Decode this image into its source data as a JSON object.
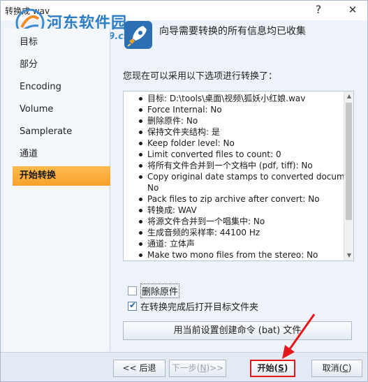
{
  "window": {
    "title": "转换成 wav",
    "help_glyph": "?",
    "close_glyph": "✕"
  },
  "watermark": {
    "text": "河东软件园",
    "url": "www.pc0359.cn"
  },
  "header": {
    "text": "向导需要转换的所有信息均已收集"
  },
  "sidebar": {
    "items": [
      {
        "label": "目标"
      },
      {
        "label": "部分"
      },
      {
        "label": "Encoding"
      },
      {
        "label": "Volume"
      },
      {
        "label": "Samplerate"
      },
      {
        "label": "通道"
      },
      {
        "label": "开始转换"
      }
    ]
  },
  "content": {
    "title": "您现在可以采用以下选项进行转换了：",
    "items": [
      "目标: D:\\tools\\桌面\\视频\\狐妖小红娘.wav",
      "Force Internal: No",
      "删除原件: No",
      "保持文件夹结构: 是",
      "Keep folder level: No",
      "Limit converted files to count: 0",
      "将所有文件合并到一个文档中 (pdf, tiff): No",
      "Copy original date stamps to converted document",
      "No",
      "Pack files to zip archive after convert: No",
      "转换成: WAV",
      "将源文件合并到一个唱集中: No",
      "生成音频的采样率: 44100 Hz",
      "通道: 立体声",
      "Make two mono files from the stereo: No"
    ]
  },
  "options": {
    "delete_original": {
      "label": "删除原件",
      "checked": false
    },
    "open_folder": {
      "label": "在转换完成后打开目标文件夹",
      "checked": true
    },
    "bat_button": "用当前设置创建命令 (bat) 文件"
  },
  "buttons": {
    "back": "<< 后退",
    "next_prefix": "下一步(",
    "next_key": "N",
    "next_suffix": ")>>",
    "start_prefix": "开始(",
    "start_key": "S",
    "start_suffix": ")",
    "cancel_prefix": "取消(",
    "cancel_key": "C",
    "cancel_suffix": ")"
  },
  "colors": {
    "accent_active": "#f7a12a",
    "annotation_red": "#e3161b"
  }
}
